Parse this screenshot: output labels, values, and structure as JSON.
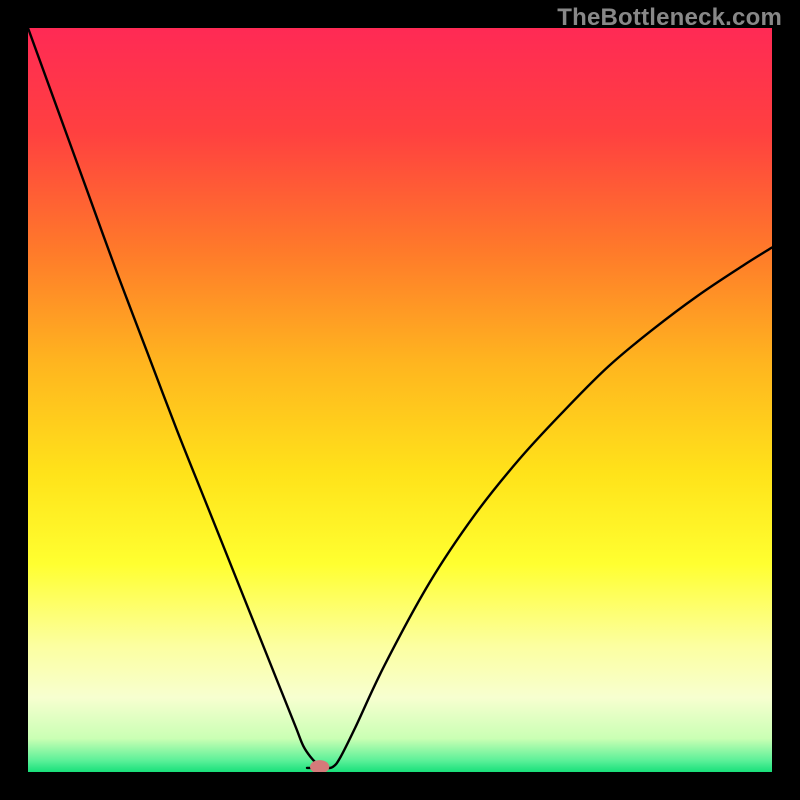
{
  "watermark": "TheBottleneck.com",
  "chart_data": {
    "type": "line",
    "title": "",
    "xlabel": "",
    "ylabel": "",
    "xlim": [
      0,
      100
    ],
    "ylim": [
      0,
      100
    ],
    "gradient_stops": [
      {
        "pos": 0.0,
        "color": "#ff2a55"
      },
      {
        "pos": 0.14,
        "color": "#ff4040"
      },
      {
        "pos": 0.3,
        "color": "#ff7a2a"
      },
      {
        "pos": 0.45,
        "color": "#ffb51f"
      },
      {
        "pos": 0.6,
        "color": "#ffe31a"
      },
      {
        "pos": 0.72,
        "color": "#ffff30"
      },
      {
        "pos": 0.83,
        "color": "#fcffa0"
      },
      {
        "pos": 0.9,
        "color": "#f7ffd0"
      },
      {
        "pos": 0.955,
        "color": "#caffb4"
      },
      {
        "pos": 0.985,
        "color": "#5af098"
      },
      {
        "pos": 1.0,
        "color": "#18e07a"
      }
    ],
    "series": [
      {
        "name": "bottleneck-curve",
        "x": [
          0,
          4,
          8,
          12,
          16,
          20,
          24,
          28,
          32,
          34,
          36,
          37,
          38,
          39,
          40,
          41,
          42,
          44,
          48,
          54,
          60,
          66,
          72,
          78,
          84,
          90,
          96,
          100
        ],
        "y": [
          100,
          89,
          78,
          67,
          56.5,
          46,
          36,
          26,
          16,
          11,
          6,
          3.5,
          2.0,
          1.0,
          0.6,
          0.7,
          2.0,
          6.0,
          14.5,
          25.5,
          34.5,
          42.0,
          48.5,
          54.5,
          59.5,
          64.0,
          68.0,
          70.5
        ]
      }
    ],
    "flat_bottom": {
      "x0": 37.5,
      "x1": 40.5,
      "y": 0.55
    },
    "marker": {
      "x": 39.2,
      "y": 0.7,
      "rx": 1.3,
      "ry": 0.9,
      "color": "#d47a7a"
    }
  }
}
